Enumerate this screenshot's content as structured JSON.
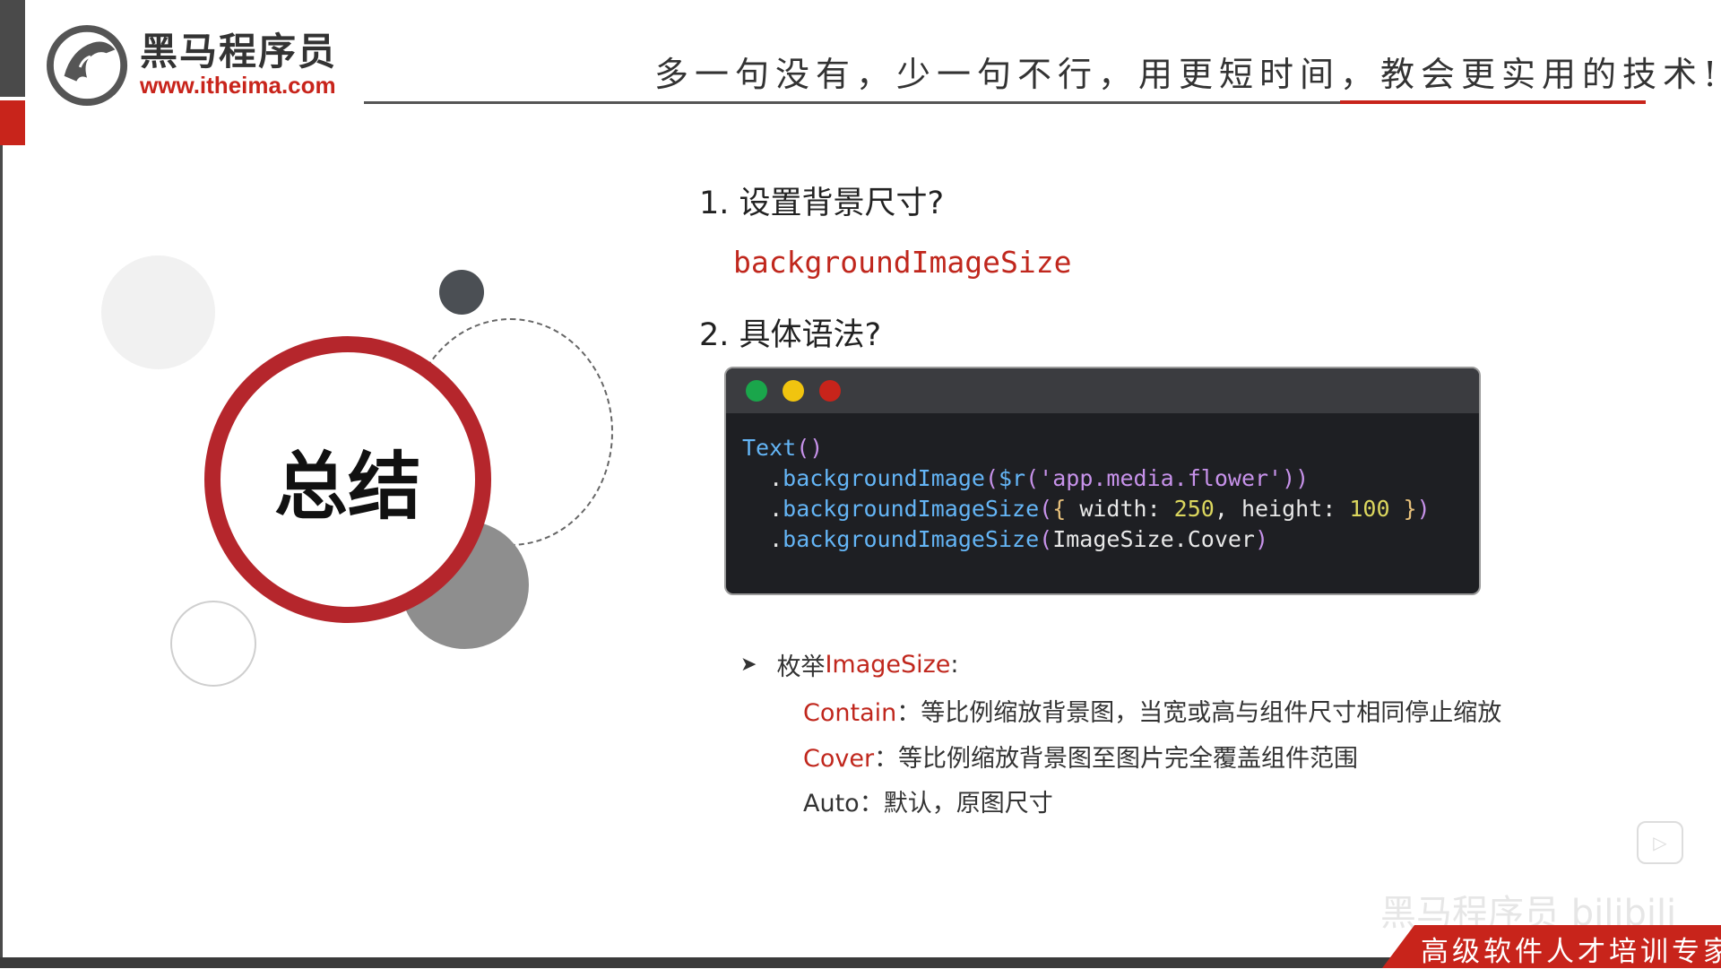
{
  "header": {
    "brand_cn": "黑马程序员",
    "brand_url": "www.itheima.com",
    "slogan": "多一句没有，少一句不行，用更短时间，教会更实用的技术!"
  },
  "summary_label": "总结",
  "q1": {
    "text": "1. 设置背景尺寸?",
    "answer": "backgroundImageSize"
  },
  "q2": {
    "text": "2. 具体语法?"
  },
  "code": {
    "window_dots": [
      "#1aa64b",
      "#f1c40f",
      "#c8241b"
    ],
    "line1": {
      "fn": "Text",
      "parens": "()"
    },
    "line2": {
      "indent": "  .",
      "fn": "backgroundImage",
      "open": "(",
      "call": "$r",
      "arg": "'app.media.flower'",
      "close": "))"
    },
    "line3": {
      "indent": "  .",
      "fn": "backgroundImageSize",
      "open": "(",
      "brace_open": "{ ",
      "k1": "width: ",
      "v1": "250",
      "comma": ", ",
      "k2": "height: ",
      "v2": "100",
      "brace_close": " }",
      "close": ")"
    },
    "line4": {
      "indent": "  .",
      "fn": "backgroundImageSize",
      "open": "(",
      "enum": "ImageSize.Cover",
      "close": ")"
    }
  },
  "enum_section": {
    "bullet": "➤",
    "prefix": "枚举 ",
    "name": "ImageSize",
    "suffix": ":",
    "items": [
      {
        "key": "Contain",
        "desc": "：等比例缩放背景图，当宽或高与组件尺寸相同停止缩放"
      },
      {
        "key": "Cover",
        "desc": "：等比例缩放背景图至图片完全覆盖组件范围"
      },
      {
        "key": "Auto",
        "desc": "：默认，原图尺寸"
      }
    ]
  },
  "footer": {
    "banner": "高级软件人才培训专家",
    "watermark": "黑马程序员 bilibili"
  },
  "colors": {
    "brand_red": "#c8241b",
    "code_bg": "#1e1f23"
  }
}
